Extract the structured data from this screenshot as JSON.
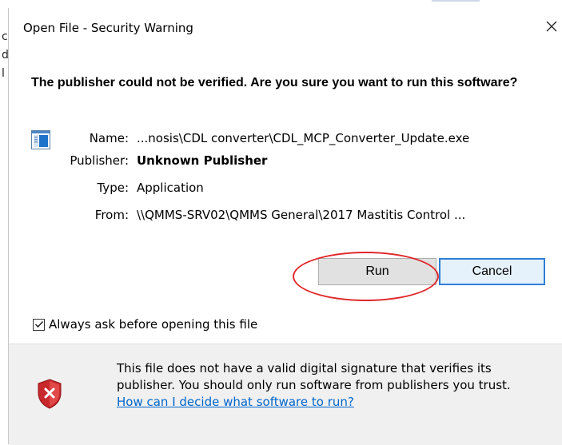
{
  "background": {
    "edge_chars": [
      "c",
      "d",
      "l"
    ]
  },
  "dialog": {
    "title": "Open File - Security Warning",
    "close_symbol": "×",
    "question": "The publisher could not be verified.  Are you sure you want to run this software?",
    "app_icon": "application-icon",
    "fields": {
      "name_label": "Name:",
      "name_value": "...nosis\\CDL converter\\CDL_MCP_Converter_Update.exe",
      "publisher_label": "Publisher:",
      "publisher_value": "Unknown Publisher",
      "type_label": "Type:",
      "type_value": "Application",
      "from_label": "From:",
      "from_value": "\\\\QMMS-SRV02\\QMMS General\\2017 Mastitis Control ..."
    },
    "buttons": {
      "run_label": "Run",
      "cancel_label": "Cancel"
    },
    "checkbox": {
      "label": "Always ask before opening this file",
      "checked": true
    },
    "footer": {
      "icon": "security-shield-icon",
      "message": "This file does not have a valid digital signature that verifies its publisher.  You should only run software from publishers you trust.",
      "link": "How can I decide what software to run?"
    },
    "colors": {
      "accent": "#2f7fd5",
      "annotation": "#e0262a",
      "link": "#0066cc",
      "footer_bg": "#f0f0f0"
    }
  }
}
